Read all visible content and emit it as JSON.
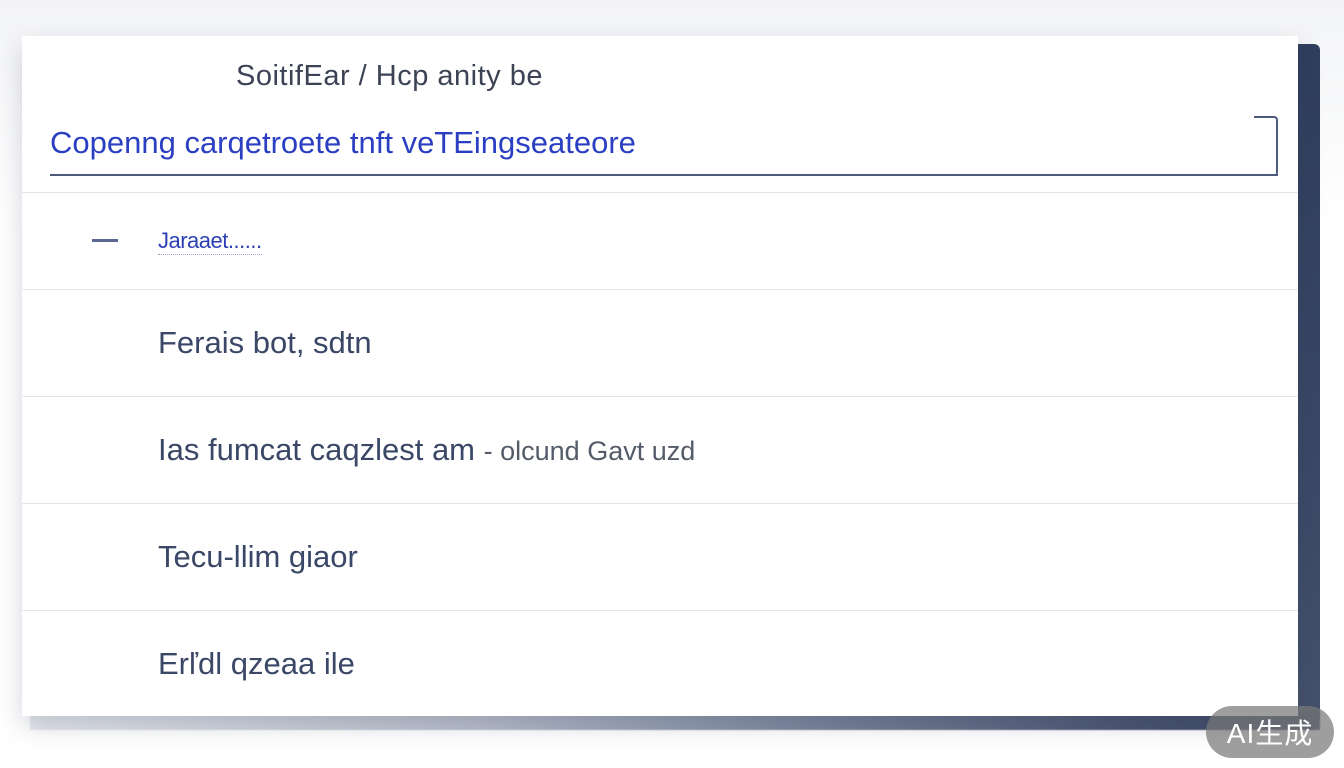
{
  "panel": {
    "label": "SoitifEar / Hcp anity be"
  },
  "search": {
    "value": "Copenng carqetroete tnft veTEingseateore"
  },
  "list": {
    "items": [
      {
        "label": "Jaraaet......",
        "active": true
      },
      {
        "label": "Ferais bot, sdtn",
        "active": false
      },
      {
        "label": "Ias fumcat caqzlest am",
        "suffix": "- olcund Gavt uzd",
        "active": false
      },
      {
        "label": "Tecu-llim giaor",
        "active": false
      },
      {
        "label": "Erľdl qzeaa ile",
        "active": false
      }
    ]
  },
  "watermark": {
    "text": "AI生成"
  },
  "colors": {
    "accent": "#2a3fc2",
    "text": "#3a4766",
    "frame": "#2f3e5c"
  }
}
